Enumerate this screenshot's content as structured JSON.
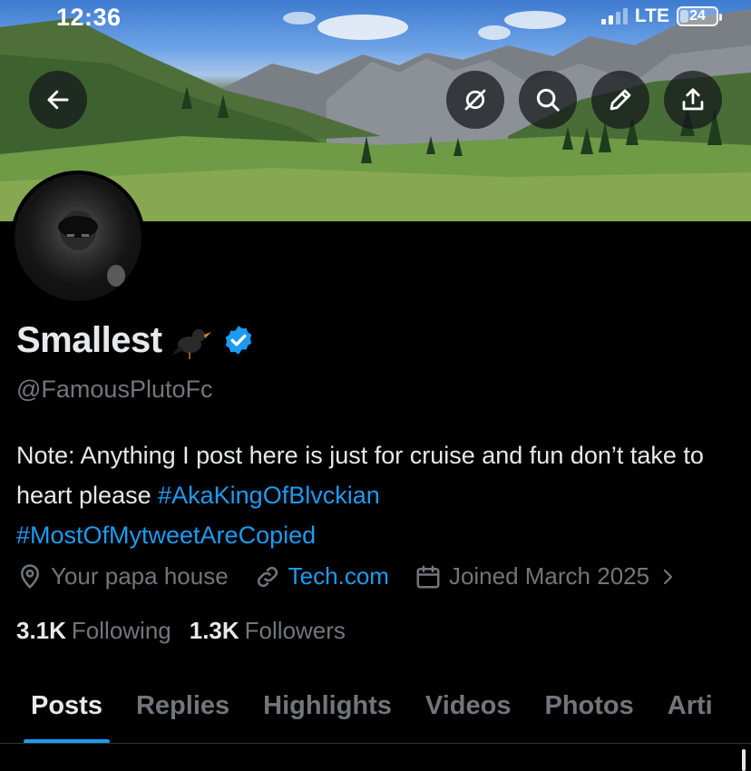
{
  "status_bar": {
    "time": "12:36",
    "network": "LTE",
    "battery_level": "24",
    "battery_fraction": 0.24
  },
  "top_actions": {
    "back_icon": "arrow-left-icon",
    "grok_icon": "grok-icon",
    "search_icon": "search-icon",
    "edit_icon": "pencil-icon",
    "share_icon": "share-icon"
  },
  "profile": {
    "display_name": "Smallest",
    "name_emoji": "blackbird-emoji",
    "verified": true,
    "handle": "@FamousPlutoFc",
    "bio_text": "Note: Anything I post here is just for cruise and fun don’t take to heart please ",
    "bio_hashtags": [
      "#AkaKingOfBlvckian",
      "#MostOfMytweetAreCopied"
    ],
    "location": "Your papa house",
    "website": "Tech.com",
    "joined": "Joined March 2025",
    "following_count": "3.1K",
    "following_label": "Following",
    "followers_count": "1.3K",
    "followers_label": "Followers"
  },
  "tabs": [
    {
      "label": "Posts",
      "active": true
    },
    {
      "label": "Replies",
      "active": false
    },
    {
      "label": "Highlights",
      "active": false
    },
    {
      "label": "Videos",
      "active": false
    },
    {
      "label": "Photos",
      "active": false
    },
    {
      "label": "Arti",
      "active": false
    }
  ],
  "colors": {
    "accent": "#1d9bf0",
    "background": "#000000",
    "text_primary": "#e7e9ea",
    "text_secondary": "#71767b"
  }
}
